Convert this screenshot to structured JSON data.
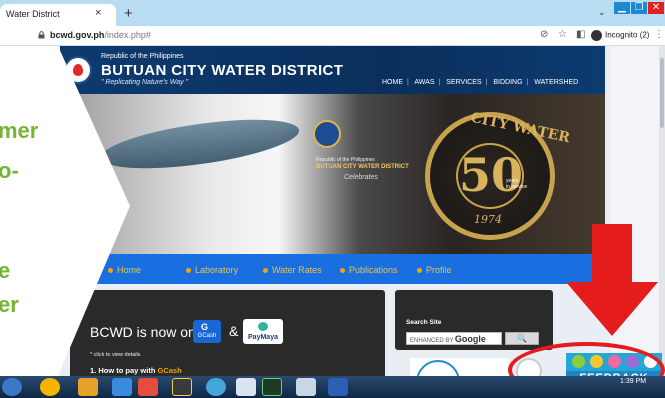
{
  "browser": {
    "tab_title": "Water District",
    "tab_close": "×",
    "new_tab": "+",
    "url_host": "bcwd.gov.ph",
    "url_path": "/index.php#",
    "profile": "Incognito (2)",
    "tab_menu": "⌄",
    "win_min": "▁",
    "win_max": "❐",
    "win_close": "✕"
  },
  "header": {
    "republic": "Republic of the Philippines",
    "title": "BUTUAN CITY WATER DISTRICT",
    "tagline": "\" Replicating Nature's Way \"",
    "nav": [
      "HOME",
      "AWAS",
      "SERVICES",
      "BIDDING",
      "WATERSHED"
    ]
  },
  "hero": {
    "republic": "Republic of the Philippines",
    "name": "BUTUAN CITY WATER DISTRICT",
    "celebrates": "Celebrates",
    "anniv_top": "CITY WATER",
    "anniv_number": "50",
    "anniv_years_1": "years",
    "anniv_years_2": "in service",
    "anniv_year": "1974"
  },
  "menu": [
    "Home",
    "Laboratory",
    "Water Rates",
    "Publications",
    "Profile"
  ],
  "content": {
    "title": "BCWD is now on",
    "gcash": "GCash",
    "amp": "&",
    "paymaya": "PayMaya",
    "note": "* click to view details",
    "how_prefix": "1. How to pay with ",
    "how_brand": "GCash"
  },
  "search": {
    "title": "Search Site",
    "placeholder_prefix": "ENHANCED BY",
    "placeholder_brand": "Google",
    "button": "🔍"
  },
  "feedback": {
    "label": "FEEDBACK"
  },
  "overlay": {
    "lines": [
      "mer",
      "o-",
      "e",
      "er"
    ]
  },
  "taskbar": {
    "time": "1:39 PM"
  },
  "colors": {
    "accent_blue": "#1a6fe0",
    "navy": "#0d3b70",
    "highlight_red": "#e51c1c",
    "overlay_green": "#74b632",
    "menu_text": "#e9c24c"
  }
}
